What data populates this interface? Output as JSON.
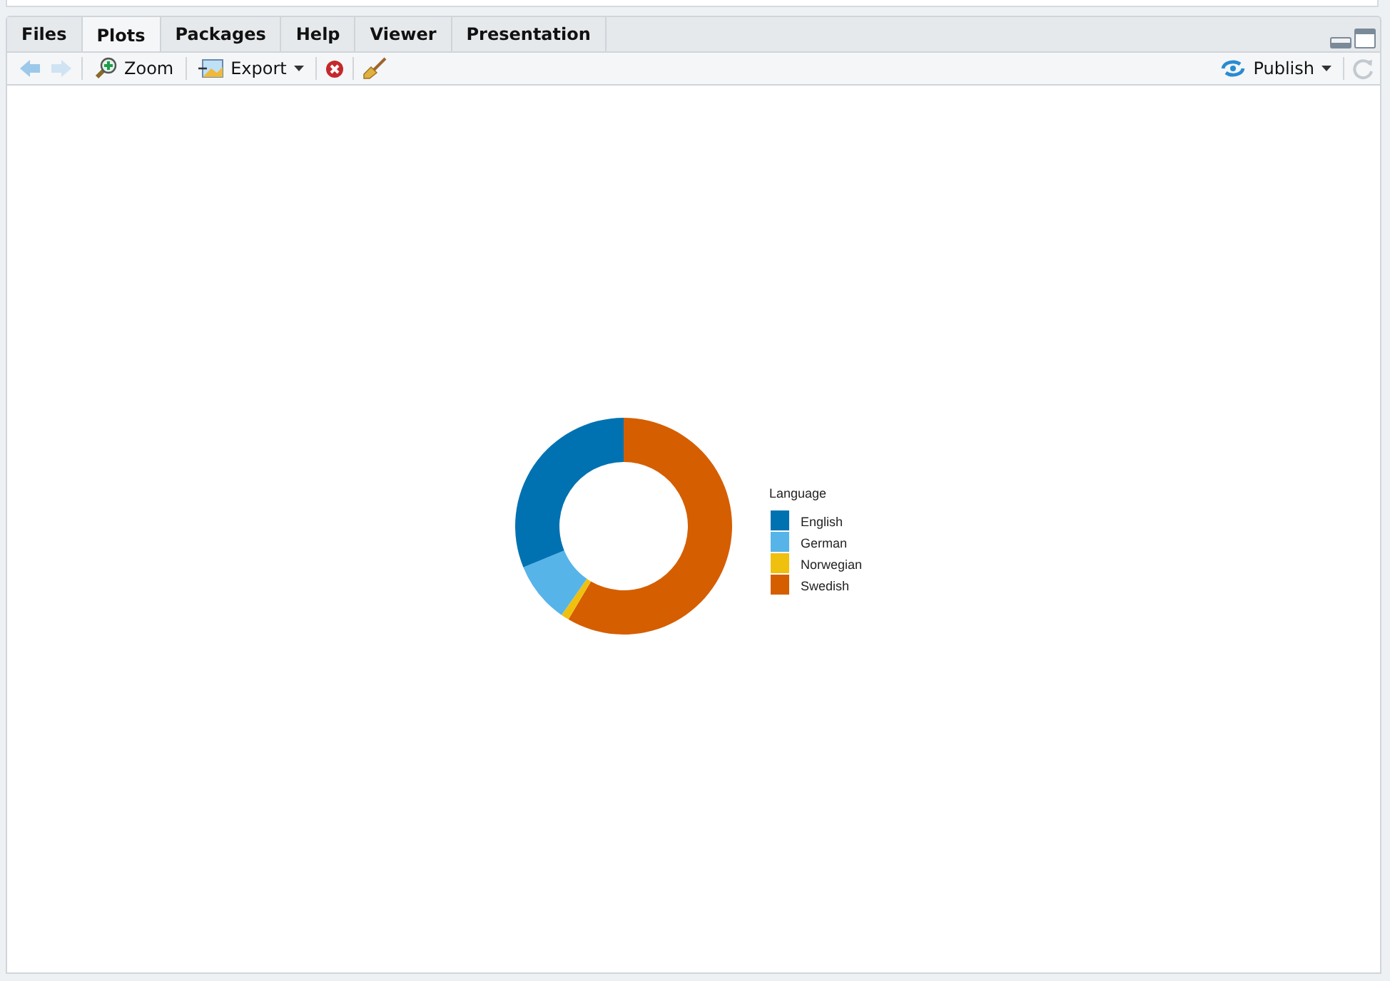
{
  "tabs": [
    {
      "label": "Files",
      "selected": false
    },
    {
      "label": "Plots",
      "selected": true
    },
    {
      "label": "Packages",
      "selected": false
    },
    {
      "label": "Help",
      "selected": false
    },
    {
      "label": "Viewer",
      "selected": false
    },
    {
      "label": "Presentation",
      "selected": false
    }
  ],
  "toolbar": {
    "zoom": "Zoom",
    "export": "Export",
    "publish": "Publish"
  },
  "plot": {
    "chart_data": {
      "type": "donut",
      "legend_title": "Language",
      "categories": [
        "English",
        "German",
        "Norwegian",
        "Swedish"
      ],
      "values": [
        0.312,
        0.091,
        0.012,
        0.585
      ],
      "colors": [
        "#0072b2",
        "#56b4e9",
        "#f0c00f",
        "#d55e00"
      ],
      "legend": "right"
    }
  }
}
